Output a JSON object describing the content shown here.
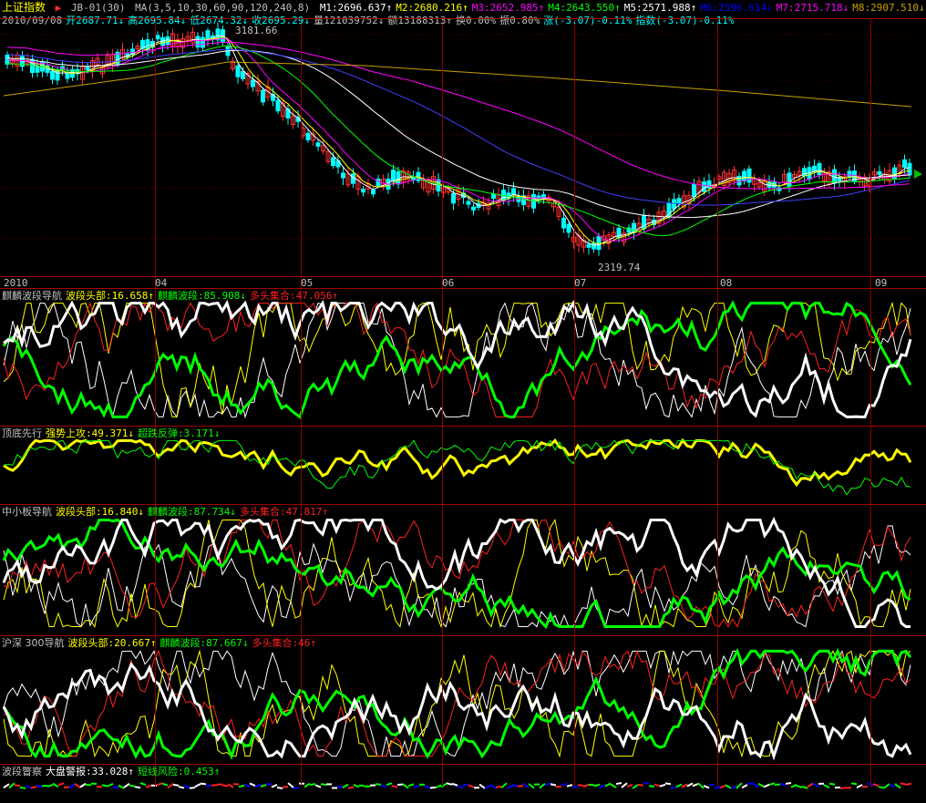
{
  "header": {
    "title": "上证指数",
    "marker": "▶",
    "indicator": "JB-01(30)",
    "ma_label": "MA(3,5,10,30,60,90,120,240,8)",
    "ma": [
      {
        "text": "M1:2696.637↑",
        "color": "#ffffff"
      },
      {
        "text": "M2:2680.216↑",
        "color": "#ffff00"
      },
      {
        "text": "M3:2652.985↑",
        "color": "#ff00ff"
      },
      {
        "text": "M4:2643.550↑",
        "color": "#00ff00"
      },
      {
        "text": "M5:2571.988↑",
        "color": "#ffffff"
      },
      {
        "text": "M6:2596.614↓",
        "color": "#0000ff"
      },
      {
        "text": "M7:2715.718↓",
        "color": "#ff00ff"
      },
      {
        "text": "M8:2907.510↓",
        "color": "#c8a000"
      }
    ],
    "info": [
      {
        "text": "2010/09/08",
        "color": "#c0c0c0"
      },
      {
        "text": "开2687.71↓",
        "color": "#00ffff"
      },
      {
        "text": "高2695.84↓",
        "color": "#00ffff"
      },
      {
        "text": "低2674.32↓",
        "color": "#00ffff"
      },
      {
        "text": "收2695.29↓",
        "color": "#00ffff"
      },
      {
        "text": "量121039752↓",
        "color": "#c0c0c0"
      },
      {
        "text": "额13188313↑",
        "color": "#c0c0c0"
      },
      {
        "text": "换0.00%",
        "color": "#c0c0c0"
      },
      {
        "text": "振0.80%",
        "color": "#c0c0c0"
      },
      {
        "text": "涨(-3.07)-0.11%",
        "color": "#00ffff"
      },
      {
        "text": "指数(-3.07)-0.11%",
        "color": "#00ffff"
      }
    ],
    "high_marker": "3181.66",
    "low_marker": "2319.74"
  },
  "date_axis": [
    "2010",
    "04",
    "05",
    "06",
    "07",
    "08",
    "09"
  ],
  "panels": [
    {
      "name": "麒麟波段导航",
      "items": [
        {
          "text": "波段头部:16.658↑",
          "color": "#ffff00"
        },
        {
          "text": "麒麟波段:85.908↓",
          "color": "#00ff00"
        },
        {
          "text": "多头集合:47.056↑",
          "color": "#ff2020"
        }
      ]
    },
    {
      "name": "顶底先行",
      "items": [
        {
          "text": "强势上攻:49.371↓",
          "color": "#ffff00"
        },
        {
          "text": "超跌反弹:3.171↓",
          "color": "#00ff00"
        }
      ]
    },
    {
      "name": "中小板导航",
      "items": [
        {
          "text": "波段头部:16.840↓",
          "color": "#ffff00"
        },
        {
          "text": "麒麟波段:87.734↓",
          "color": "#00ff00"
        },
        {
          "text": "多头集合:47.817↑",
          "color": "#ff2020"
        }
      ]
    },
    {
      "name": "沪深 300导航",
      "items": [
        {
          "text": "波段头部:20.667↑",
          "color": "#ffff00"
        },
        {
          "text": "麒麟波段:87.667↓",
          "color": "#00ff00"
        },
        {
          "text": "多头集合:46↑",
          "color": "#ff2020"
        }
      ]
    },
    {
      "name": "波段瞥察",
      "items": [
        {
          "text": "大盘警报:33.028↑",
          "color": "#ffffff"
        },
        {
          "text": "短线风险:0.453↑",
          "color": "#00ff00"
        }
      ]
    }
  ],
  "colors": {
    "up": "#ff3030",
    "down": "#00ffff",
    "separator": "#a00000"
  }
}
